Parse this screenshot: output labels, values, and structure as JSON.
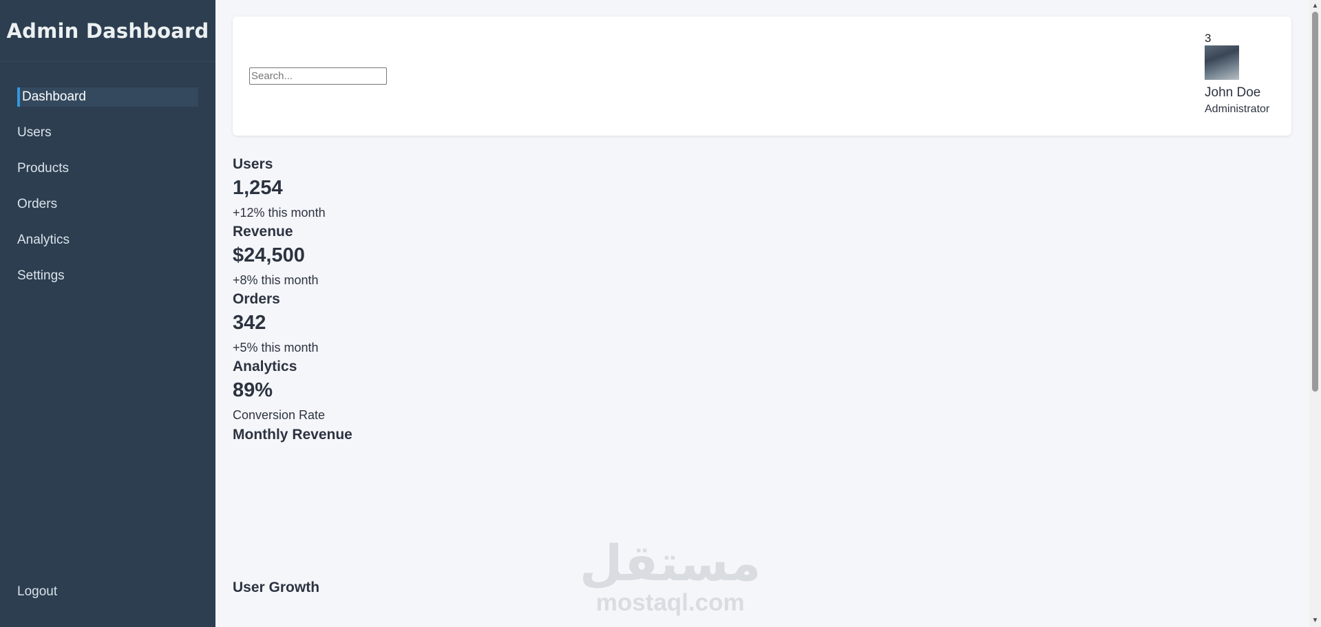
{
  "sidebar": {
    "title": "Admin Dashboard",
    "items": [
      {
        "label": "Dashboard",
        "active": true
      },
      {
        "label": "Users"
      },
      {
        "label": "Products"
      },
      {
        "label": "Orders"
      },
      {
        "label": "Analytics"
      },
      {
        "label": "Settings"
      }
    ],
    "logout": "Logout"
  },
  "header": {
    "search": {
      "placeholder": "Search...",
      "value": ""
    },
    "notifications": "3",
    "user": {
      "name": "John Doe",
      "role": "Administrator"
    }
  },
  "stats": [
    {
      "title": "Users",
      "value": "1,254",
      "sub": "+12% this month"
    },
    {
      "title": "Revenue",
      "value": "$24,500",
      "sub": "+8% this month"
    },
    {
      "title": "Orders",
      "value": "342",
      "sub": "+5% this month"
    },
    {
      "title": "Analytics",
      "value": "89%",
      "sub": "Conversion Rate"
    }
  ],
  "sections": {
    "monthly_revenue": "Monthly Revenue",
    "user_growth": "User Growth"
  },
  "watermark": {
    "logo": "مستقل",
    "text": "mostaql.com"
  },
  "colors": {
    "sidebar_bg": "#2c3e50",
    "active_accent": "#3498db",
    "page_bg": "#f5f6fa"
  }
}
